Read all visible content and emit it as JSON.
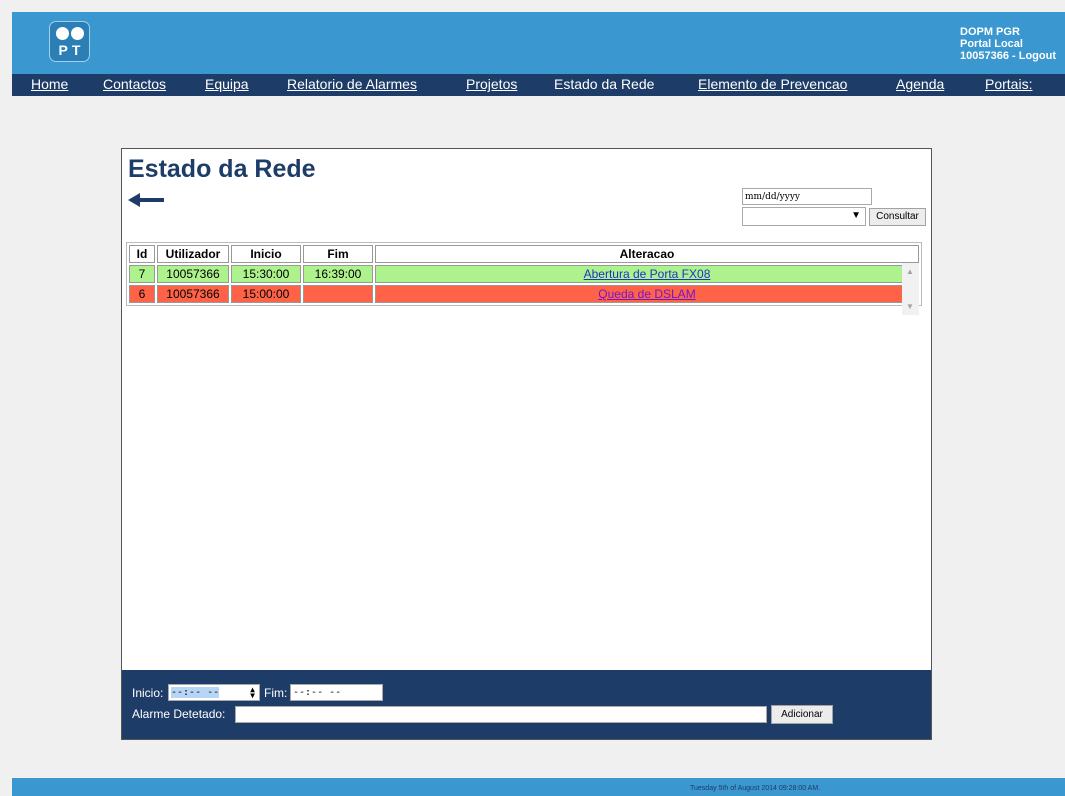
{
  "header": {
    "logo_text": "PT",
    "org": "DOPM PGR",
    "portal": "Portal Local",
    "user": "10057366",
    "logout": "Logout"
  },
  "nav": {
    "items": [
      {
        "label": "Home"
      },
      {
        "label": "Contactos"
      },
      {
        "label": "Equipa"
      },
      {
        "label": "Relatorio de Alarmes"
      },
      {
        "label": "Projetos"
      },
      {
        "label": "Estado da Rede"
      },
      {
        "label": "Elemento de Prevencao"
      },
      {
        "label": "Agenda"
      },
      {
        "label": "Portais:"
      }
    ]
  },
  "main": {
    "title": "Estado da Rede",
    "date_placeholder": "mm/dd/yyyy",
    "select_value": "",
    "consultar_label": "Consultar",
    "table": {
      "columns": [
        "Id",
        "Utilizador",
        "Inicio",
        "Fim",
        "Alteracao"
      ],
      "rows": [
        {
          "id": "7",
          "user": "10057366",
          "start": "15:30:00",
          "end": "16:39:00",
          "change": "Abertura de Porta FX08",
          "status_color": "#adf28c"
        },
        {
          "id": "6",
          "user": "10057366",
          "start": "15:00:00",
          "end": "",
          "change": "Queda de DSLAM",
          "status_color": "#ff6347"
        }
      ]
    },
    "form": {
      "inicio_label": "Inicio:",
      "inicio_value": "--:-- --",
      "fim_label": "Fim:",
      "fim_value": "--:-- --",
      "alarm_label": "Alarme Detetado:",
      "alarm_value": "",
      "add_label": "Adicionar"
    }
  },
  "footer": {
    "timestamp": "Tuesday 5th of August 2014 09:28:00 AM."
  },
  "colors": {
    "topbar": "#3a97cf",
    "navbar": "#1d3c67",
    "ok_row": "#adf28c",
    "alarm_row": "#ff6347"
  }
}
